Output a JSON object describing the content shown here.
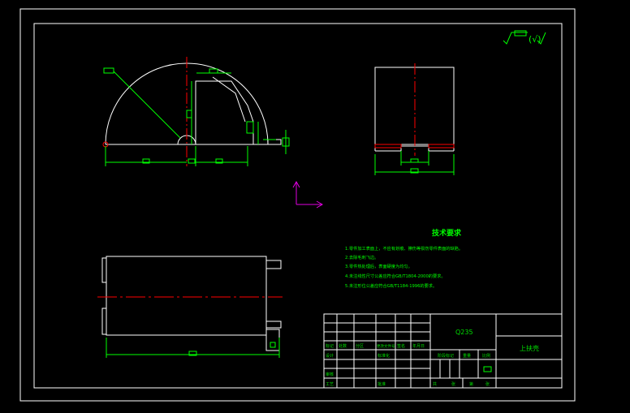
{
  "colors": {
    "background": "#000000",
    "outline": "#ffffff",
    "centerline": "#ff0000",
    "dimension": "#00ff00",
    "text": "#00ff00",
    "axis": "#e000e0"
  },
  "surface_finish": {
    "symbol_label": "√",
    "separator": "(√)"
  },
  "tech_requirements": {
    "title": "技术要求",
    "items": [
      "1.零件加工表面上，不应有划痕、擦伤等损伤零件表面的缺陷。",
      "2.去除毛刺飞边。",
      "3.零件热处理后，表面硬度为均匀。",
      "4.未注线性尺寸公差应符合GB/T1804-2000的要求。",
      "5.未注形位公差应符合GB/T1184-1996的要求。"
    ]
  },
  "title_block": {
    "material": "Q235",
    "part_name": "上扶壳",
    "labels": {
      "mark": "标记",
      "count": "处数",
      "zone": "分区",
      "change_doc": "更改文件号",
      "signature": "签名",
      "date": "年月日",
      "design": "设计",
      "standardization": "标准化",
      "review": "审核",
      "process": "工艺",
      "approve": "批准",
      "stage_mark": "阶段标记",
      "weight": "重量",
      "scale": "比例",
      "sheet_total": "共",
      "sheet_unit": "张",
      "sheet_no": "第"
    }
  }
}
